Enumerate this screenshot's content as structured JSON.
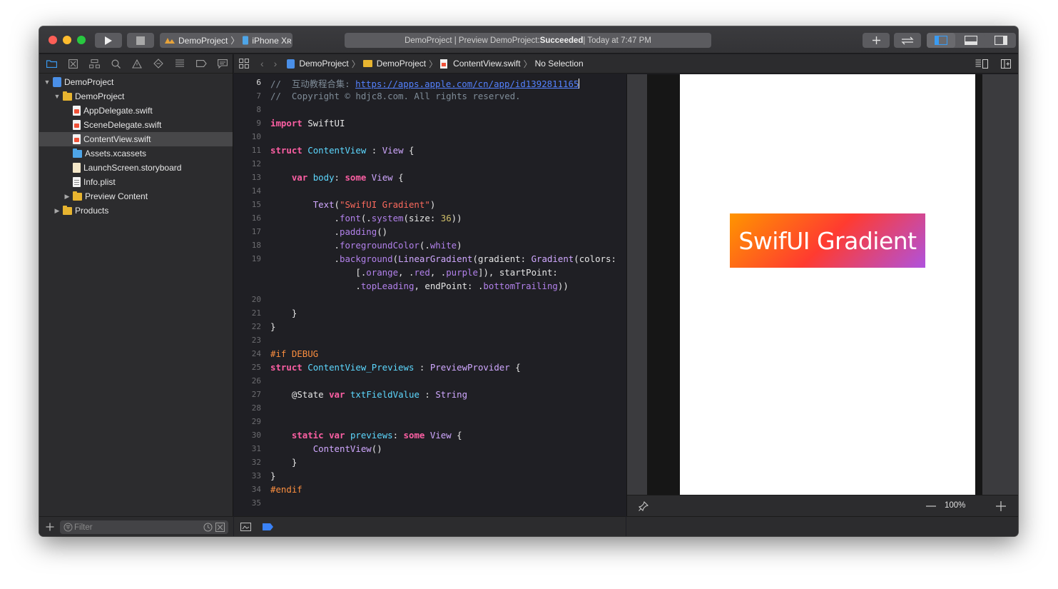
{
  "toolbar": {
    "scheme": "DemoProject",
    "device": "iPhone Xʀ",
    "status_prefix": "DemoProject | Preview DemoProject: ",
    "status_result": "Succeeded",
    "status_suffix": " | Today at 7:47 PM"
  },
  "navigator": {
    "items": [
      {
        "label": "DemoProject"
      },
      {
        "label": "DemoProject"
      },
      {
        "label": "AppDelegate.swift"
      },
      {
        "label": "SceneDelegate.swift"
      },
      {
        "label": "ContentView.swift"
      },
      {
        "label": "Assets.xcassets"
      },
      {
        "label": "LaunchScreen.storyboard"
      },
      {
        "label": "Info.plist"
      },
      {
        "label": "Preview Content"
      },
      {
        "label": "Products"
      }
    ],
    "filter_placeholder": "Filter"
  },
  "jumpbar": {
    "crumbs": [
      "DemoProject",
      "DemoProject",
      "ContentView.swift",
      "No Selection"
    ]
  },
  "editor": {
    "line_numbers": [
      "6",
      "7",
      "8",
      "9",
      "10",
      "11",
      "12",
      "13",
      "14",
      "15",
      "16",
      "17",
      "18",
      "19",
      "20",
      "21",
      "22",
      "23",
      "24",
      "25",
      "26",
      "27",
      "28",
      "29",
      "30",
      "31",
      "32",
      "33",
      "34",
      "35"
    ],
    "comment_cn": "互动教程合集: ",
    "url": "https://apps.apple.com/cn/app/id1392811165",
    "copyright": "//  Copyright © hdjc8.com. All rights reserved.",
    "preview_text_literal": "\"SwifUI Gradient\"",
    "font_size": "36"
  },
  "preview": {
    "text": "SwifUI Gradient",
    "gradient_colors": [
      "#ff9500",
      "#ff3b30",
      "#af52de"
    ],
    "zoom": "100%"
  }
}
